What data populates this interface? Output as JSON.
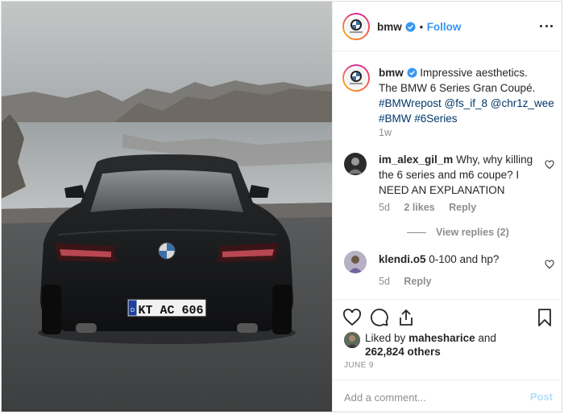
{
  "header": {
    "username": "bmw",
    "separator": "•",
    "follow_label": "Follow"
  },
  "caption": {
    "username": "bmw",
    "line1": "Impressive aesthetics.",
    "line2": "The BMW 6 Series Gran Coupé.",
    "line3a": "#BMWrepost",
    "line3b": "@fs_if_8",
    "line3c": "@chr1z_wee",
    "line4a": "#BMW",
    "line4b": "#6Series",
    "time": "1w"
  },
  "comments": [
    {
      "username": "im_alex_gil_m",
      "line1": "Why, why killing",
      "line2": "the 6 series and m6 coupe? I",
      "line3": "NEED AN EXPLANATION",
      "time": "5d",
      "likes": "2 likes",
      "reply_label": "Reply",
      "view_replies": "View replies (2)"
    },
    {
      "username": "klendi.o5",
      "line1": "0-100 and hp?",
      "time": "5d",
      "reply_label": "Reply"
    }
  ],
  "likes": {
    "prefix": "Liked by",
    "user": "mahesharice",
    "and": "and",
    "count": "262,824 others"
  },
  "date": "JUNE 9",
  "add_comment": {
    "placeholder": "Add a comment...",
    "post_label": "Post"
  },
  "photo": {
    "license_plate": "KT AC 606",
    "plate_prefix": "D"
  },
  "colors": {
    "link_blue": "#3897f0",
    "hashtag": "#00376b",
    "muted": "#8e8e8e",
    "verified": "#3897f0",
    "post_disabled": "#b2dffc"
  },
  "icons": [
    "more-icon",
    "verified-icon",
    "heart-icon",
    "comment-icon",
    "share-icon",
    "bookmark-icon"
  ]
}
